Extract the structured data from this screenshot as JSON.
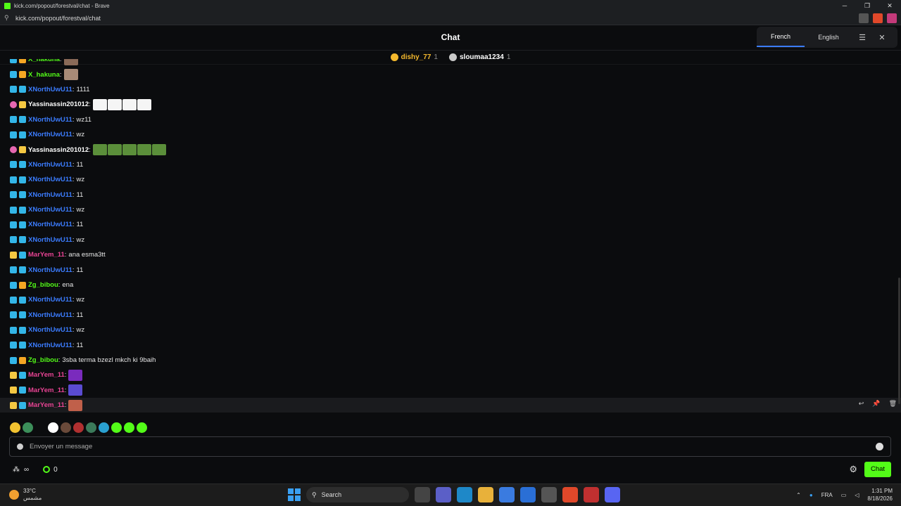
{
  "window": {
    "title": "kick.com/popout/forestval/chat - Brave",
    "controls": [
      "─",
      "❐",
      "✕"
    ]
  },
  "urlbar": {
    "url": "kick.com/popout/forestval/chat"
  },
  "header": {
    "title": "Chat",
    "translate": {
      "languages": [
        "French",
        "English"
      ],
      "active": "French"
    }
  },
  "pinned": [
    {
      "name": "dishy_77",
      "count": "1",
      "color": "#f5b92d"
    },
    {
      "name": "sloumaa1234",
      "count": "1",
      "color": "#c9c9c9"
    }
  ],
  "messages": [
    {
      "user": "X_hakuna",
      "sep": ":",
      "text": "",
      "color": "#53fc18",
      "badges": [
        "#33b6e8",
        "#f5a623"
      ],
      "emotes": [
        "#8a6a58"
      ],
      "partial": true
    },
    {
      "user": "X_hakuna",
      "sep": ":",
      "text": "",
      "color": "#53fc18",
      "badges": [
        "#33b6e8",
        "#f5a623"
      ],
      "emotes": [
        "#a98b78"
      ]
    },
    {
      "user": "XNorthUwU11",
      "sep": ":",
      "text": "1111",
      "color": "#3b7cff",
      "badges": [
        "#33b6e8",
        "#33b6e8"
      ],
      "emotes": []
    },
    {
      "user": "Yassinassin201012",
      "sep": ":",
      "text": "",
      "color": "#ffffff",
      "badges": [
        "#e567b0",
        "#f5c842"
      ],
      "emotes": [
        "#f5f5f5",
        "#f5f5f5",
        "#f5f5f5",
        "#f5f5f5"
      ]
    },
    {
      "user": "XNorthUwU11",
      "sep": ":",
      "text": "wz11",
      "color": "#3b7cff",
      "badges": [
        "#33b6e8",
        "#33b6e8"
      ],
      "emotes": []
    },
    {
      "user": "XNorthUwU11",
      "sep": ":",
      "text": "wz",
      "color": "#3b7cff",
      "badges": [
        "#33b6e8",
        "#33b6e8"
      ],
      "emotes": []
    },
    {
      "user": "Yassinassin201012",
      "sep": ":",
      "text": "",
      "color": "#ffffff",
      "badges": [
        "#e567b0",
        "#f5c842"
      ],
      "emotes": [
        "#5b8f3a",
        "#5b8f3a",
        "#5b8f3a",
        "#5b8f3a",
        "#5b8f3a"
      ]
    },
    {
      "user": "XNorthUwU11",
      "sep": ":",
      "text": "11",
      "color": "#3b7cff",
      "badges": [
        "#33b6e8",
        "#33b6e8"
      ],
      "emotes": []
    },
    {
      "user": "XNorthUwU11",
      "sep": ":",
      "text": "wz",
      "color": "#3b7cff",
      "badges": [
        "#33b6e8",
        "#33b6e8"
      ],
      "emotes": []
    },
    {
      "user": "XNorthUwU11",
      "sep": ":",
      "text": "11",
      "color": "#3b7cff",
      "badges": [
        "#33b6e8",
        "#33b6e8"
      ],
      "emotes": []
    },
    {
      "user": "XNorthUwU11",
      "sep": ":",
      "text": "wz",
      "color": "#3b7cff",
      "badges": [
        "#33b6e8",
        "#33b6e8"
      ],
      "emotes": []
    },
    {
      "user": "XNorthUwU11",
      "sep": ":",
      "text": "11",
      "color": "#3b7cff",
      "badges": [
        "#33b6e8",
        "#33b6e8"
      ],
      "emotes": []
    },
    {
      "user": "XNorthUwU11",
      "sep": ":",
      "text": "wz",
      "color": "#3b7cff",
      "badges": [
        "#33b6e8",
        "#33b6e8"
      ],
      "emotes": []
    },
    {
      "user": "MarYem_11",
      "sep": ":",
      "text": "ana esma3tt",
      "color": "#e84393",
      "badges": [
        "#f5c842",
        "#33b6e8"
      ],
      "emotes": []
    },
    {
      "user": "XNorthUwU11",
      "sep": ":",
      "text": "11",
      "color": "#3b7cff",
      "badges": [
        "#33b6e8",
        "#33b6e8"
      ],
      "emotes": []
    },
    {
      "user": "Zg_bibou",
      "sep": ":",
      "text": "ena",
      "color": "#53fc18",
      "badges": [
        "#33b6e8",
        "#f5a623"
      ],
      "emotes": []
    },
    {
      "user": "XNorthUwU11",
      "sep": ":",
      "text": "wz",
      "color": "#3b7cff",
      "badges": [
        "#33b6e8",
        "#33b6e8"
      ],
      "emotes": []
    },
    {
      "user": "XNorthUwU11",
      "sep": ":",
      "text": "11",
      "color": "#3b7cff",
      "badges": [
        "#33b6e8",
        "#33b6e8"
      ],
      "emotes": []
    },
    {
      "user": "XNorthUwU11",
      "sep": ":",
      "text": "wz",
      "color": "#3b7cff",
      "badges": [
        "#33b6e8",
        "#33b6e8"
      ],
      "emotes": []
    },
    {
      "user": "XNorthUwU11",
      "sep": ":",
      "text": "11",
      "color": "#3b7cff",
      "badges": [
        "#33b6e8",
        "#33b6e8"
      ],
      "emotes": []
    },
    {
      "user": "Zg_bibou",
      "sep": ":",
      "text": "3sba terma bzezl mkch ki 9baih",
      "color": "#53fc18",
      "badges": [
        "#33b6e8",
        "#f5a623"
      ],
      "emotes": []
    },
    {
      "user": "MarYem_11",
      "sep": ":",
      "text": "",
      "color": "#e84393",
      "badges": [
        "#f5c842",
        "#33b6e8"
      ],
      "emotes": [
        "#7a2bbd"
      ]
    },
    {
      "user": "MarYem_11",
      "sep": ":",
      "text": "",
      "color": "#e84393",
      "badges": [
        "#f5c842",
        "#33b6e8"
      ],
      "emotes": [
        "#5a4bd1"
      ]
    },
    {
      "user": "MarYem_11",
      "sep": ":",
      "text": "",
      "color": "#e84393",
      "badges": [
        "#f5c842",
        "#33b6e8"
      ],
      "emotes": [
        "#c0604a"
      ],
      "hover": true
    }
  ],
  "message_actions": [
    "reply-icon",
    "pin-icon",
    "delete-icon"
  ],
  "emote_bar": [
    "#f2c230",
    "#3c8f5a",
    "#0b0c0e",
    "#ffffff",
    "#6a4a3a",
    "#b03030",
    "#3b7a5a",
    "#2aa0d0",
    "#53fc18",
    "#53fc18",
    "#53fc18"
  ],
  "input": {
    "placeholder": "Envoyer un message"
  },
  "bottom": {
    "points": "0",
    "chat_button": "Chat",
    "left_glyph": "∞"
  },
  "taskbar": {
    "temp": "33°C",
    "weather": "مشمس",
    "search": "Search",
    "lang": "FRA",
    "time": "1:31 PM",
    "date": "8/18/2026"
  }
}
